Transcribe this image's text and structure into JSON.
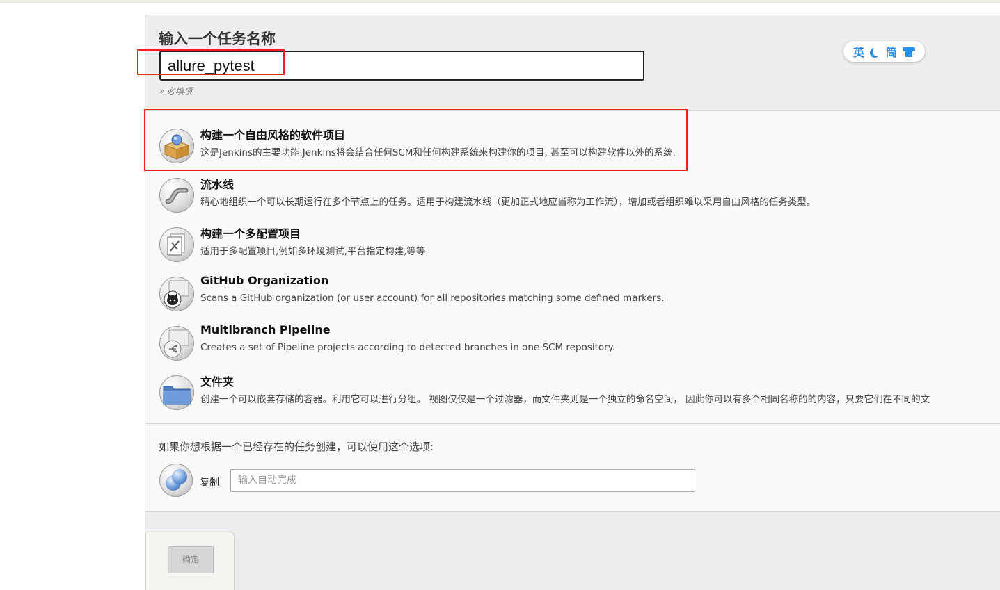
{
  "name_section": {
    "title": "输入一个任务名称",
    "value": "allure_pytest",
    "required_note": "» 必填项"
  },
  "lang_widget": {
    "lang": "英",
    "script": "简",
    "icons": [
      "moon-icon",
      "shirt-icon"
    ],
    "accent_color": "#2a8ee6"
  },
  "job_types": [
    {
      "title": "构建一个自由风格的软件项目",
      "desc": "这是Jenkins的主要功能.Jenkins将会结合任何SCM和任何构建系统来构建你的项目, 甚至可以构建软件以外的系统.",
      "icon": "freestyle-box-icon"
    },
    {
      "title": "流水线",
      "desc": "精心地组织一个可以长期运行在多个节点上的任务。适用于构建流水线（更加正式地应当称为工作流），增加或者组织难以采用自由风格的任务类型。",
      "icon": "pipeline-icon"
    },
    {
      "title": "构建一个多配置项目",
      "desc": "适用于多配置项目,例如多环境测试,平台指定构建,等等.",
      "icon": "multi-config-icon"
    },
    {
      "title": "GitHub Organization",
      "desc": "Scans a GitHub organization (or user account) for all repositories matching some defined markers.",
      "icon": "github-icon"
    },
    {
      "title": "Multibranch Pipeline",
      "desc": "Creates a set of Pipeline projects according to detected branches in one SCM repository.",
      "icon": "multibranch-icon"
    },
    {
      "title": "文件夹",
      "desc": "创建一个可以嵌套存储的容器。利用它可以进行分组。 视图仅仅是一个过滤器，而文件夹则是一个独立的命名空间， 因此你可以有多个相同名称的的内容，只要它们在不同的文",
      "icon": "folder-icon"
    }
  ],
  "copy_section": {
    "hint": "如果你想根据一个已经存在的任务创建，可以使用这个选项:",
    "label": "复制",
    "placeholder": "输入自动完成"
  },
  "footer": {
    "ok_label": "确定"
  },
  "annotation_color": "#e8231a"
}
